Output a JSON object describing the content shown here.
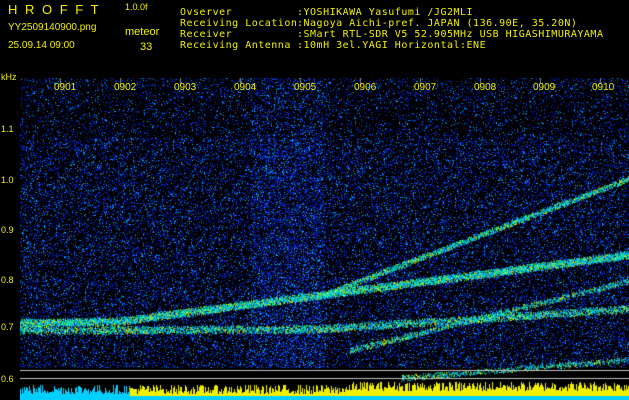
{
  "header": {
    "program": "H R O F F T",
    "version": "1.0.0f",
    "filename": "YY2509140900.png",
    "datetime": "25.09.14 09:00",
    "meteor_label": "meteor",
    "meteor_count": "33",
    "info": [
      {
        "label": "Ovserver",
        "value": ":YOSHIKAWA Yasufumi /JG2MLI"
      },
      {
        "label": "Receiving Location",
        "value": ":Nagoya Aichi-pref. JAPAN (136.90E, 35.20N)"
      },
      {
        "label": "Receiver",
        "value": ":SMart RTL-SDR V5 52.905MHz USB HIGASHIMURAYAMA"
      },
      {
        "label": "Receiving Antenna",
        "value": ":10mH 3el.YAGI Horizontal:ENE"
      }
    ]
  },
  "axes": {
    "y_unit": "kHz",
    "y_ticks": [
      "1.1",
      "1.0",
      "0.9",
      "0.8",
      "0.7",
      "0.6"
    ],
    "x_ticks": [
      "0901",
      "0902",
      "0903",
      "0904",
      "0905",
      "0906",
      "0907",
      "0908",
      "0909",
      "0910"
    ]
  },
  "colors": {
    "text": "#f0f000",
    "background": "#000000",
    "noise_low": "#0a1aa0",
    "noise_high": "#00c8ff",
    "signal": "#f0f000",
    "level_bar": "#f0f000",
    "baseline": "#00d0ff"
  }
}
